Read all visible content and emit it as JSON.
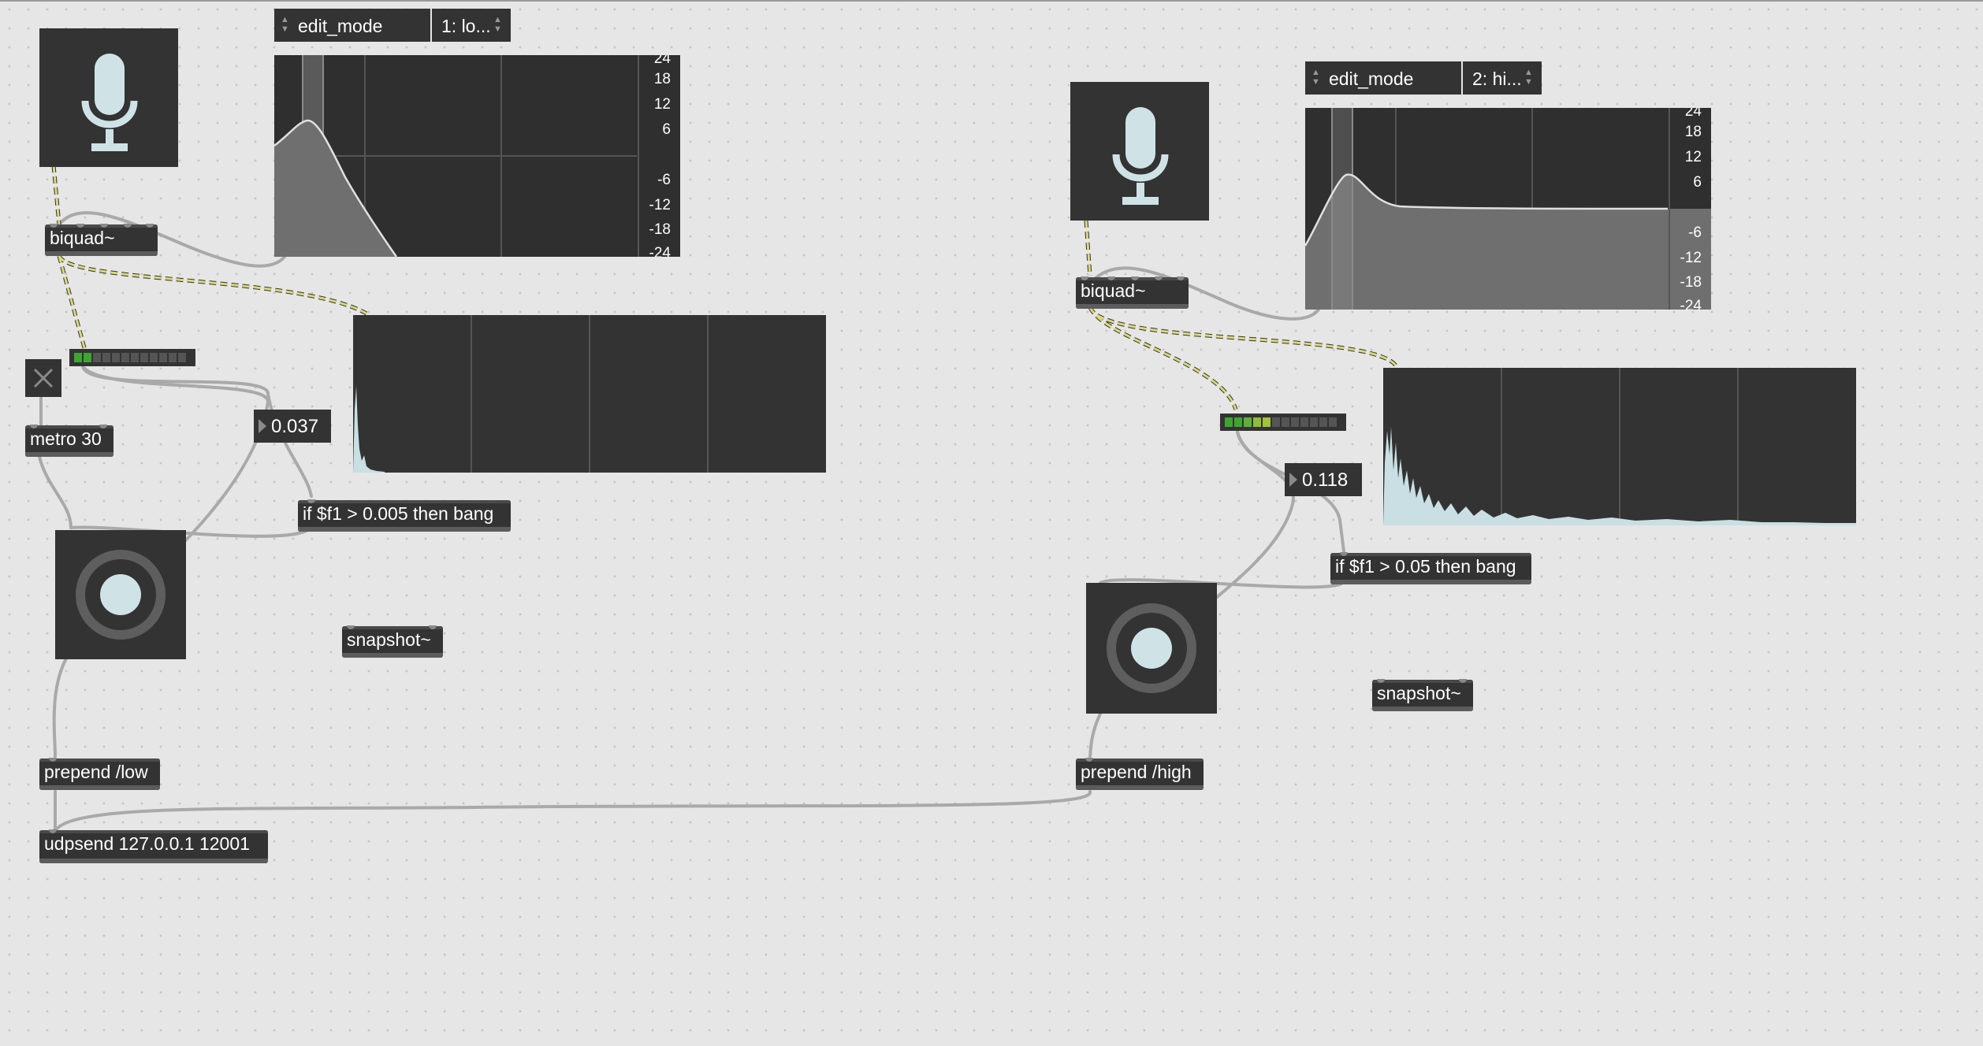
{
  "colors": {
    "canvas": "#e6e6e6",
    "object": "#333333",
    "patchcord": "#a9a9a9",
    "signal_cord": "#d9d97a",
    "meter_green": "#3fa531",
    "meter_yellow": "#9fc33a",
    "spectrum_fill": "#c9dfe3"
  },
  "left": {
    "mic_icon": "microphone-icon",
    "biquad": "biquad~",
    "filter_mode": {
      "param": "edit_mode",
      "value": "1: lo..."
    },
    "filter_db_labels": [
      "24",
      "18",
      "12",
      "6",
      "-6",
      "-12",
      "-18",
      "-24"
    ],
    "toggle_icon": "x-icon",
    "metro": "metro 30",
    "number_value": "0.037",
    "if_object": "if $f1 > 0.005 then bang",
    "snapshot": "snapshot~",
    "prepend": "prepend /low",
    "udpsend": "udpsend 127.0.0.1 12001",
    "meter_level": 0.2
  },
  "right": {
    "mic_icon": "microphone-icon",
    "biquad": "biquad~",
    "filter_mode": {
      "param": "edit_mode",
      "value": "2: hi..."
    },
    "filter_db_labels": [
      "24",
      "18",
      "12",
      "6",
      "-6",
      "-12",
      "-18",
      "-24"
    ],
    "number_value": "0.118",
    "if_object": "if $f1 > 0.05 then bang",
    "snapshot": "snapshot~",
    "prepend": "prepend /high",
    "meter_level": 0.5
  }
}
